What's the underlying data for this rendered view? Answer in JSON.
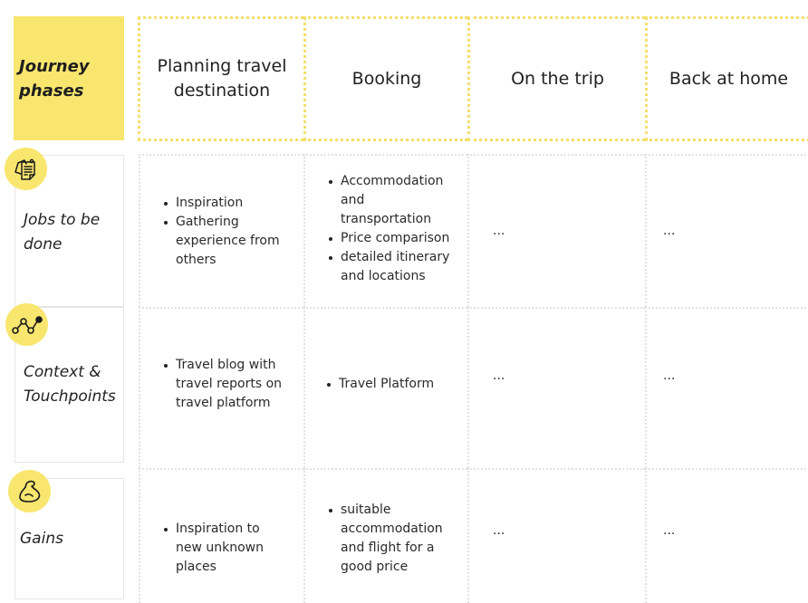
{
  "header": {
    "label": "Journey\nphases",
    "phases": [
      "Planning travel destination",
      "Booking",
      "On the trip",
      "Back at home"
    ]
  },
  "rows": [
    {
      "label": "Jobs to be\ndone",
      "icon": "sticky-notes-icon",
      "cells": [
        [
          "Inspiration",
          "Gathering experience from others"
        ],
        [
          "Accommodation and transportation",
          "Price comparison",
          "detailed itinerary and locations"
        ],
        "...",
        "..."
      ]
    },
    {
      "label": "Context &\nTouchpoints",
      "icon": "connected-path-icon",
      "cells": [
        [
          "Travel blog with travel reports on travel platform"
        ],
        [
          "Travel Platform"
        ],
        "...",
        "..."
      ]
    },
    {
      "label": "Gains",
      "icon": "flexed-biceps-icon",
      "cells": [
        [
          "Inspiration to new unknown places"
        ],
        [
          "suitable accommodation and flight for a good price"
        ],
        "...",
        "..."
      ]
    }
  ],
  "colors": {
    "accent_yellow": "#f9e66f",
    "header_dots": "#f5df6a",
    "grid_dots": "#e2e2e2"
  }
}
